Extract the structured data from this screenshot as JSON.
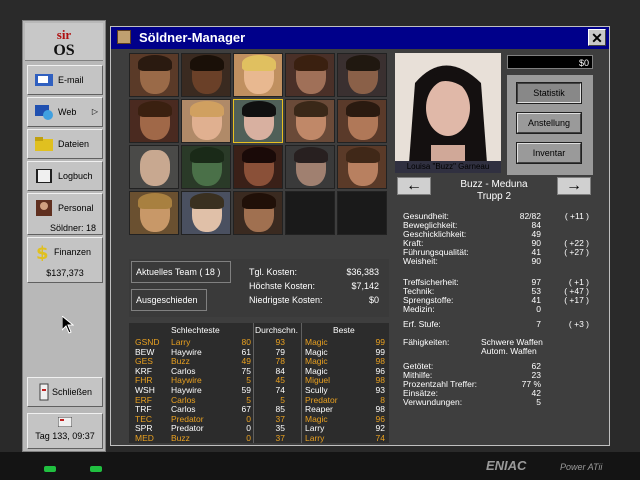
{
  "sidebar": {
    "logo_top": "sir",
    "logo_bottom": "OS",
    "email": "E-mail",
    "web": "Web",
    "files": "Dateien",
    "logbook": "Logbuch",
    "personnel": "Personal",
    "soldiers": "Söldner: 18",
    "finances": "Finanzen",
    "balance": "$137,373",
    "close": "Schließen",
    "date": "Tag 133, 09:37"
  },
  "window": {
    "title": "Söldner-Manager",
    "close_glyph": "✕"
  },
  "team": {
    "current_team": "Aktuelles Team ( 18 )",
    "departed": "Ausgeschieden",
    "daily_cost_label": "Tgl. Kosten:",
    "daily_cost": "$36,383",
    "max_cost_label": "Höchste Kosten:",
    "max_cost": "$7,142",
    "min_cost_label": "Niedrigste Kosten:",
    "min_cost": "$0"
  },
  "stats_table": {
    "headers": {
      "worst": "Schlechteste",
      "avg": "Durchschn.",
      "best": "Beste"
    },
    "rows": [
      {
        "attr": "GSND",
        "worst": "Larry",
        "wv": "80",
        "avg": "93",
        "best": "Magic",
        "bv": "99",
        "hl": true
      },
      {
        "attr": "BEW",
        "worst": "Haywire",
        "wv": "61",
        "avg": "79",
        "best": "Magic",
        "bv": "99",
        "hl": false
      },
      {
        "attr": "GES",
        "worst": "Buzz",
        "wv": "49",
        "avg": "78",
        "best": "Magic",
        "bv": "98",
        "hl": true
      },
      {
        "attr": "KRF",
        "worst": "Carlos",
        "wv": "75",
        "avg": "84",
        "best": "Magic",
        "bv": "96",
        "hl": false
      },
      {
        "attr": "FHR",
        "worst": "Haywire",
        "wv": "5",
        "avg": "45",
        "best": "Miguel",
        "bv": "98",
        "hl": true
      },
      {
        "attr": "WSH",
        "worst": "Haywire",
        "wv": "59",
        "avg": "74",
        "best": "Scully",
        "bv": "93",
        "hl": false
      },
      {
        "attr": "ERF",
        "worst": "Carlos",
        "wv": "5",
        "avg": "5",
        "best": "Predator",
        "bv": "8",
        "hl": true
      },
      {
        "attr": "TRF",
        "worst": "Carlos",
        "wv": "67",
        "avg": "85",
        "best": "Reaper",
        "bv": "98",
        "hl": false
      },
      {
        "attr": "TEC",
        "worst": "Predator",
        "wv": "0",
        "avg": "37",
        "best": "Magic",
        "bv": "96",
        "hl": true
      },
      {
        "attr": "SPR",
        "worst": "Predator",
        "wv": "0",
        "avg": "35",
        "best": "Larry",
        "bv": "92",
        "hl": false
      },
      {
        "attr": "MED",
        "worst": "Buzz",
        "wv": "0",
        "avg": "37",
        "best": "Larry",
        "bv": "74",
        "hl": true
      }
    ]
  },
  "detail": {
    "money": "$0",
    "btn_stats": "Statistik",
    "btn_employ": "Anstellung",
    "btn_inventory": "Inventar",
    "portrait_caption": "Louisa \"Buzz\" Garneau",
    "name": "Buzz - Meduna",
    "squad": "Trupp 2",
    "prev_glyph": "←",
    "next_glyph": "→",
    "rows": [
      {
        "l": "Gesundheit:",
        "v": "82/82",
        "b": "( +11 )"
      },
      {
        "l": "Beweglichkeit:",
        "v": "84",
        "b": ""
      },
      {
        "l": "Geschicklichkeit:",
        "v": "49",
        "b": ""
      },
      {
        "l": "Kraft:",
        "v": "90",
        "b": "( +22 )"
      },
      {
        "l": "Führungsqualität:",
        "v": "41",
        "b": "( +27 )"
      },
      {
        "l": "Weisheit:",
        "v": "90",
        "b": ""
      },
      {
        "l": "Treffsicherheit:",
        "v": "97",
        "b": "( +1 )"
      },
      {
        "l": "Technik:",
        "v": "53",
        "b": "( +47 )"
      },
      {
        "l": "Sprengstoffe:",
        "v": "41",
        "b": "( +17 )"
      },
      {
        "l": "Medizin:",
        "v": "0",
        "b": ""
      },
      {
        "l": "Erf. Stufe:",
        "v": "7",
        "b": "( +3 )"
      }
    ],
    "skills_label": "Fähigkeiten:",
    "skill1": "Schwere Waffen",
    "skill2": "Autom. Waffen",
    "record": [
      {
        "l": "Getötet:",
        "v": "62"
      },
      {
        "l": "Mithilfe:",
        "v": "23"
      },
      {
        "l": "Prozentzahl Treffer:",
        "v": "77 %"
      },
      {
        "l": "Einsätze:",
        "v": "42"
      },
      {
        "l": "Verwundungen:",
        "v": "5"
      }
    ]
  },
  "hardware": {
    "brand": "ENIAC",
    "model": "Power ATii"
  }
}
